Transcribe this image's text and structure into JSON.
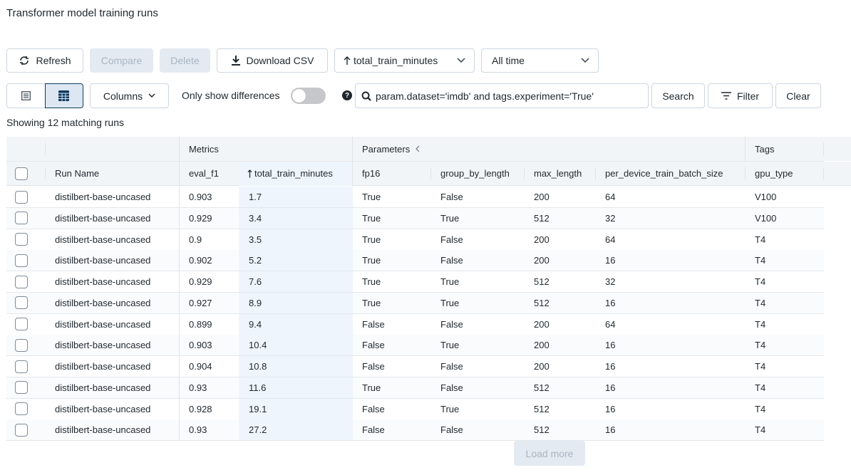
{
  "page": {
    "title": "Transformer model training runs"
  },
  "toolbar": {
    "refresh_label": "Refresh",
    "compare_label": "Compare",
    "delete_label": "Delete",
    "download_label": "Download CSV",
    "sort_label": "total_train_minutes",
    "time_label": "All time",
    "columns_label": "Columns",
    "diff_label": "Only show differences",
    "diff_enabled": false,
    "search_value": "param.dataset='imdb' and tags.experiment='True'",
    "search_button": "Search",
    "filter_button": "Filter",
    "clear_button": "Clear",
    "load_more": "Load more"
  },
  "status": {
    "count_text": "Showing 12 matching runs"
  },
  "table": {
    "groups": {
      "metrics": "Metrics",
      "parameters": "Parameters",
      "tags": "Tags"
    },
    "columns": [
      "Run Name",
      "eval_f1",
      "total_train_minutes",
      "fp16",
      "group_by_length",
      "max_length",
      "per_device_train_batch_size",
      "gpu_type"
    ],
    "sorted_column": "total_train_minutes",
    "sort_direction": "ascending",
    "rows": [
      [
        "distilbert-base-uncased",
        "0.903",
        "1.7",
        "True",
        "False",
        "200",
        "64",
        "V100"
      ],
      [
        "distilbert-base-uncased",
        "0.929",
        "3.4",
        "True",
        "True",
        "512",
        "32",
        "V100"
      ],
      [
        "distilbert-base-uncased",
        "0.9",
        "3.5",
        "True",
        "False",
        "200",
        "64",
        "T4"
      ],
      [
        "distilbert-base-uncased",
        "0.902",
        "5.2",
        "True",
        "False",
        "200",
        "16",
        "T4"
      ],
      [
        "distilbert-base-uncased",
        "0.929",
        "7.6",
        "True",
        "True",
        "512",
        "32",
        "T4"
      ],
      [
        "distilbert-base-uncased",
        "0.927",
        "8.9",
        "True",
        "True",
        "512",
        "16",
        "T4"
      ],
      [
        "distilbert-base-uncased",
        "0.899",
        "9.4",
        "False",
        "False",
        "200",
        "64",
        "T4"
      ],
      [
        "distilbert-base-uncased",
        "0.903",
        "10.4",
        "False",
        "True",
        "200",
        "16",
        "T4"
      ],
      [
        "distilbert-base-uncased",
        "0.904",
        "10.8",
        "False",
        "False",
        "200",
        "16",
        "T4"
      ],
      [
        "distilbert-base-uncased",
        "0.93",
        "11.6",
        "True",
        "False",
        "512",
        "16",
        "T4"
      ],
      [
        "distilbert-base-uncased",
        "0.928",
        "19.1",
        "False",
        "True",
        "512",
        "16",
        "T4"
      ],
      [
        "distilbert-base-uncased",
        "0.93",
        "27.2",
        "False",
        "False",
        "512",
        "16",
        "T4"
      ]
    ]
  }
}
